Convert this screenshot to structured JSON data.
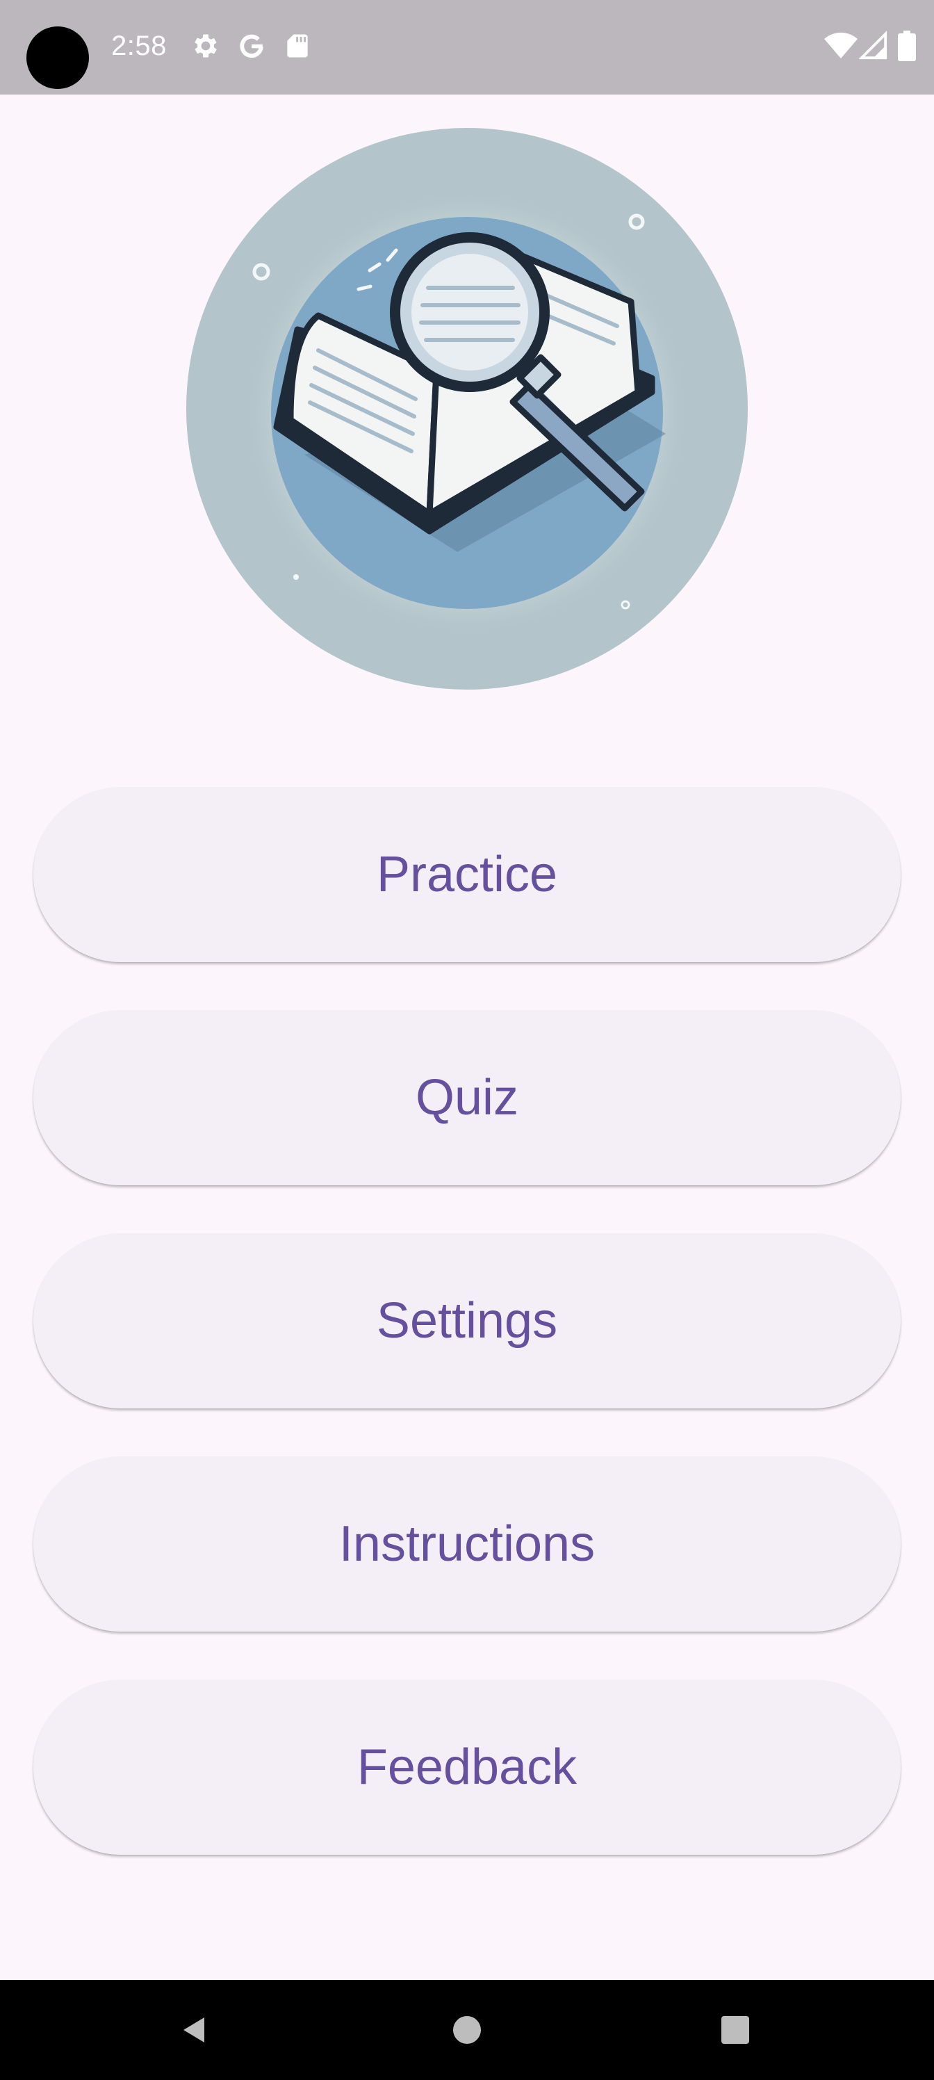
{
  "status_bar": {
    "time": "2:58",
    "icons": [
      "settings-gear-icon",
      "google-icon",
      "sd-card-icon",
      "wifi-icon",
      "cell-signal-icon",
      "battery-icon"
    ]
  },
  "hero_image": {
    "icon": "book-magnifier-illustration",
    "colors": {
      "outer_circle": "#b3c5cb",
      "inner_circle": "#7fa8c6",
      "glow": "#e9f0ef",
      "outline": "#1e2a38"
    }
  },
  "menu": {
    "buttons": [
      {
        "label": "Practice"
      },
      {
        "label": "Quiz"
      },
      {
        "label": "Settings"
      },
      {
        "label": "Instructions"
      },
      {
        "label": "Feedback"
      }
    ]
  },
  "navigation": {
    "buttons": [
      "back-icon",
      "home-icon",
      "recents-icon"
    ]
  },
  "theme": {
    "background": "#fcf6fc",
    "button_background": "#f4eff6",
    "button_text": "#64509e",
    "status_bar": "#bbb7bd"
  }
}
